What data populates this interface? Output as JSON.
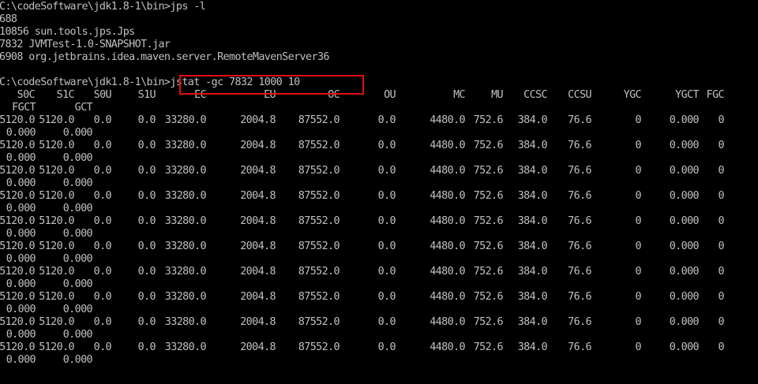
{
  "colors": {
    "background": "#000000",
    "foreground": "#c0c0c0",
    "highlight": "#e01010"
  },
  "top_lines": [
    "C:\\codeSoftware\\jdk1.8-1\\bin>jps -l",
    "688",
    "10856 sun.tools.jps.Jps",
    "7832 JVMTest-1.0-SNAPSHOT.jar",
    "6908 org.jetbrains.idea.maven.server.RemoteMavenServer36",
    "",
    "C:\\codeSoftware\\jdk1.8-1\\bin>jstat -gc 7832 1000 10"
  ],
  "headers": [
    "S0C",
    "S1C",
    "S0U",
    "S1U",
    "EC",
    "EU",
    "OC",
    "OU",
    "MC",
    "MU",
    "CCSC",
    "CCSU",
    "YGC",
    "YGCT",
    "FGC"
  ],
  "headers_wrap": [
    "FGCT",
    "GCT"
  ],
  "rows": [
    {
      "main": [
        "5120.0",
        "5120.0",
        "0.0",
        "0.0",
        "33280.0",
        "2004.8",
        "87552.0",
        "0.0",
        "4480.0",
        "752.6",
        "384.0",
        "76.6",
        "0",
        "0.000",
        "0"
      ],
      "wrap": [
        "0.000",
        "0.000"
      ]
    },
    {
      "main": [
        "5120.0",
        "5120.0",
        "0.0",
        "0.0",
        "33280.0",
        "2004.8",
        "87552.0",
        "0.0",
        "4480.0",
        "752.6",
        "384.0",
        "76.6",
        "0",
        "0.000",
        "0"
      ],
      "wrap": [
        "0.000",
        "0.000"
      ]
    },
    {
      "main": [
        "5120.0",
        "5120.0",
        "0.0",
        "0.0",
        "33280.0",
        "2004.8",
        "87552.0",
        "0.0",
        "4480.0",
        "752.6",
        "384.0",
        "76.6",
        "0",
        "0.000",
        "0"
      ],
      "wrap": [
        "0.000",
        "0.000"
      ]
    },
    {
      "main": [
        "5120.0",
        "5120.0",
        "0.0",
        "0.0",
        "33280.0",
        "2004.8",
        "87552.0",
        "0.0",
        "4480.0",
        "752.6",
        "384.0",
        "76.6",
        "0",
        "0.000",
        "0"
      ],
      "wrap": [
        "0.000",
        "0.000"
      ]
    },
    {
      "main": [
        "5120.0",
        "5120.0",
        "0.0",
        "0.0",
        "33280.0",
        "2004.8",
        "87552.0",
        "0.0",
        "4480.0",
        "752.6",
        "384.0",
        "76.6",
        "0",
        "0.000",
        "0"
      ],
      "wrap": [
        "0.000",
        "0.000"
      ]
    },
    {
      "main": [
        "5120.0",
        "5120.0",
        "0.0",
        "0.0",
        "33280.0",
        "2004.8",
        "87552.0",
        "0.0",
        "4480.0",
        "752.6",
        "384.0",
        "76.6",
        "0",
        "0.000",
        "0"
      ],
      "wrap": [
        "0.000",
        "0.000"
      ]
    },
    {
      "main": [
        "5120.0",
        "5120.0",
        "0.0",
        "0.0",
        "33280.0",
        "2004.8",
        "87552.0",
        "0.0",
        "4480.0",
        "752.6",
        "384.0",
        "76.6",
        "0",
        "0.000",
        "0"
      ],
      "wrap": [
        "0.000",
        "0.000"
      ]
    },
    {
      "main": [
        "5120.0",
        "5120.0",
        "0.0",
        "0.0",
        "33280.0",
        "2004.8",
        "87552.0",
        "0.0",
        "4480.0",
        "752.6",
        "384.0",
        "76.6",
        "0",
        "0.000",
        "0"
      ],
      "wrap": [
        "0.000",
        "0.000"
      ]
    },
    {
      "main": [
        "5120.0",
        "5120.0",
        "0.0",
        "0.0",
        "33280.0",
        "2004.8",
        "87552.0",
        "0.0",
        "4480.0",
        "752.6",
        "384.0",
        "76.6",
        "0",
        "0.000",
        "0"
      ],
      "wrap": [
        "0.000",
        "0.000"
      ]
    },
    {
      "main": [
        "5120.0",
        "5120.0",
        "0.0",
        "0.0",
        "33280.0",
        "2004.8",
        "87552.0",
        "0.0",
        "4480.0",
        "752.6",
        "384.0",
        "76.6",
        "0",
        "0.000",
        "0"
      ],
      "wrap": [
        "0.000",
        "0.000"
      ]
    }
  ]
}
